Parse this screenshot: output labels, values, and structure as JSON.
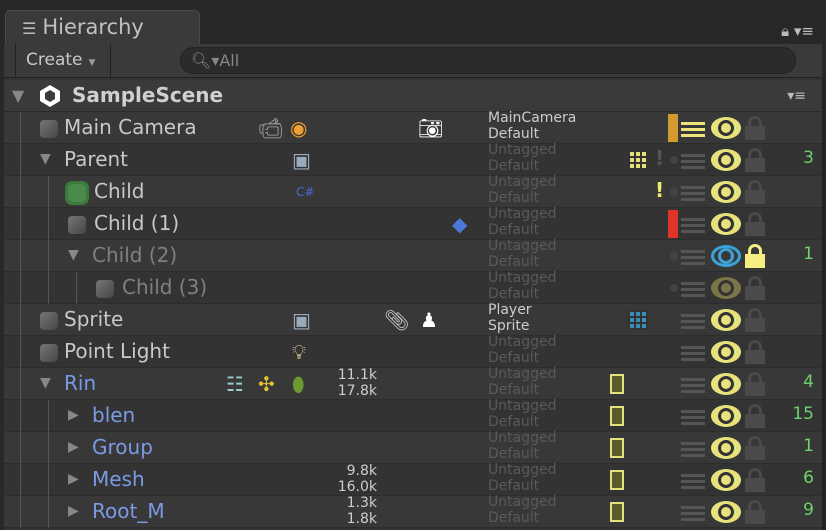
{
  "tab": {
    "title": "Hierarchy"
  },
  "toolbar": {
    "create_label": "Create",
    "search_placeholder": "All"
  },
  "scene": {
    "name": "SampleScene"
  },
  "rows": [
    {
      "name": "Main Camera",
      "depth": 0,
      "arrow": "",
      "color": "normal",
      "icons": [
        "camera-component-icon",
        "audio-listener-icon",
        "screenshot-icon"
      ],
      "stats": [],
      "tag": "MainCamera",
      "layer": "Default",
      "tag_highlight": true,
      "bar": "#d59a2f",
      "layer_on": true,
      "dot": false,
      "eye": "on",
      "lock": false,
      "count": ""
    },
    {
      "name": "Parent",
      "depth": 0,
      "arrow": "down",
      "color": "normal",
      "icons": [
        "visibility-box-icon"
      ],
      "stats": [],
      "tag": "Untagged",
      "layer": "Default",
      "grid": "yellow",
      "warn": "dim",
      "dot": true,
      "eye": "on",
      "lock": false,
      "count": "3"
    },
    {
      "name": "Child",
      "depth": 1,
      "arrow": "",
      "color": "normal",
      "selected": true,
      "icons": [
        "csharp-script-icon"
      ],
      "stats": [],
      "tag": "Untagged",
      "layer": "Default",
      "warn": "on",
      "dot": true,
      "eye": "on",
      "lock": false,
      "count": ""
    },
    {
      "name": "Child (1)",
      "depth": 1,
      "arrow": "",
      "color": "normal",
      "icons": [
        "diamond-icon"
      ],
      "stats": [],
      "tag": "Untagged",
      "layer": "Default",
      "bar": "#e0332a",
      "eye": "on",
      "lock": false,
      "count": ""
    },
    {
      "name": "Child (2)",
      "depth": 1,
      "arrow": "down",
      "color": "gray",
      "icons": [],
      "stats": [],
      "tag": "Untagged",
      "layer": "Default",
      "dot": true,
      "eye": "hidden",
      "lock": true,
      "count": "1"
    },
    {
      "name": "Child (3)",
      "depth": 2,
      "arrow": "",
      "color": "gray",
      "icons": [],
      "stats": [],
      "tag": "Untagged",
      "layer": "Default",
      "dot": true,
      "eye": "dim",
      "lock": false,
      "count": ""
    },
    {
      "name": "Sprite",
      "depth": 0,
      "arrow": "",
      "color": "normal",
      "icons": [
        "visibility-box-icon",
        "paperclip-icon",
        "character-icon"
      ],
      "stats": [],
      "tag": "Player",
      "layer": "Sprite",
      "tag_highlight": true,
      "grid": "blue",
      "eye": "on",
      "lock": false,
      "count": ""
    },
    {
      "name": "Point Light",
      "depth": 0,
      "arrow": "",
      "color": "normal",
      "icons": [
        "light-bulb-icon"
      ],
      "stats": [],
      "tag": "Untagged",
      "layer": "Default",
      "eye": "on",
      "lock": false,
      "count": ""
    },
    {
      "name": "Rin",
      "depth": 0,
      "arrow": "down",
      "color": "blue",
      "icons": [
        "animator-icon",
        "transform-gizmo-icon",
        "capsule-icon"
      ],
      "stats": [
        "11.1k",
        "17.8k"
      ],
      "tag": "Untagged",
      "layer": "Default",
      "prefab": true,
      "eye": "on",
      "lock": false,
      "count": "4"
    },
    {
      "name": "blen",
      "depth": 1,
      "arrow": "right",
      "color": "blue",
      "icons": [],
      "stats": [],
      "tag": "Untagged",
      "layer": "Default",
      "prefab": true,
      "eye": "on",
      "lock": false,
      "count": "15"
    },
    {
      "name": "Group",
      "depth": 1,
      "arrow": "right",
      "color": "blue",
      "icons": [],
      "stats": [],
      "tag": "Untagged",
      "layer": "Default",
      "prefab": true,
      "eye": "on",
      "lock": false,
      "count": "1"
    },
    {
      "name": "Mesh",
      "depth": 1,
      "arrow": "right",
      "color": "blue",
      "icons": [],
      "stats": [
        "9.8k",
        "16.0k"
      ],
      "tag": "Untagged",
      "layer": "Default",
      "prefab": true,
      "eye": "on",
      "lock": false,
      "count": "6"
    },
    {
      "name": "Root_M",
      "depth": 1,
      "arrow": "right",
      "color": "blue",
      "icons": [],
      "stats": [
        "1.3k",
        "1.8k"
      ],
      "tag": "Untagged",
      "layer": "Default",
      "prefab": true,
      "eye": "on",
      "lock": false,
      "count": "9"
    }
  ]
}
